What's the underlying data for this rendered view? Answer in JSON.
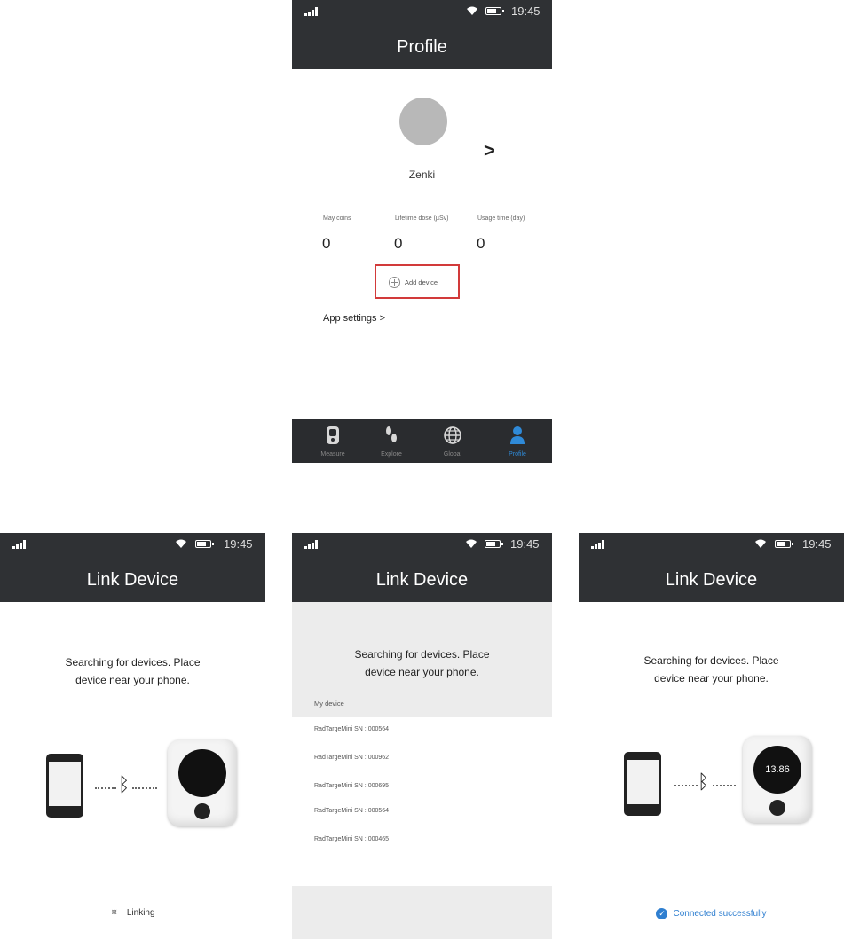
{
  "status_bar": {
    "time": "19:45"
  },
  "profile": {
    "title": "Profile",
    "username": "Zenki",
    "stats": [
      {
        "label": "May coins",
        "value": "0"
      },
      {
        "label": "Lifetime dose (µSv)",
        "value": "0"
      },
      {
        "label": "Usage time (day)",
        "value": "0"
      }
    ],
    "add_device": "Add device",
    "app_settings": "App settings >",
    "chevron": ">",
    "nav": [
      {
        "label": "Measure",
        "icon": "measure-icon"
      },
      {
        "label": "Explore",
        "icon": "footprints-icon"
      },
      {
        "label": "Global",
        "icon": "globe-icon"
      },
      {
        "label": "Profile",
        "icon": "user-icon",
        "active": true
      }
    ]
  },
  "link_device": {
    "title": "Link Device",
    "message_line1": "Searching for devices. Place",
    "message_line2": "device near your phone.",
    "linking": "Linking",
    "connected": "Connected successfully",
    "device_reading": "13.86",
    "list_header": "My device",
    "devices": [
      "RadTargeMini  SN : 000564",
      "RadTargeMini  SN : 000962",
      "RadTargeMini  SN : 000695",
      "RadTargeMini  SN : 000564",
      "RadTargeMini  SN : 000465"
    ]
  },
  "colors": {
    "header_bg": "#2f3134",
    "nav_active": "#2f8ad8",
    "highlight_box": "#d23a3a",
    "success": "#2f7fd0"
  }
}
